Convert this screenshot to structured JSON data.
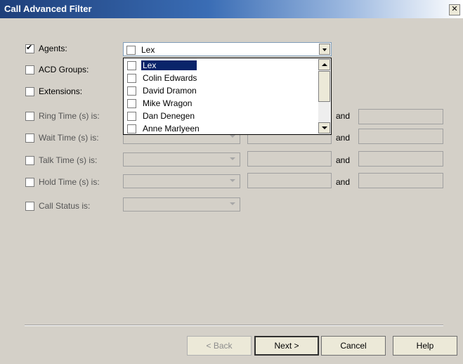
{
  "window": {
    "title": "Call Advanced Filter",
    "close_label": "✕"
  },
  "filters": {
    "agents": {
      "label": "Agents:",
      "checked": true,
      "selected": "Lex"
    },
    "acd_groups": {
      "label": "ACD Groups:"
    },
    "extensions": {
      "label": "Extensions:"
    },
    "ring_time": {
      "label": "Ring Time (s) is:",
      "and": "and"
    },
    "wait_time": {
      "label": "Wait Time (s) is:",
      "and": "and"
    },
    "talk_time": {
      "label": "Talk Time (s) is:",
      "and": "and"
    },
    "hold_time": {
      "label": "Hold Time (s) is:",
      "and": "and"
    },
    "call_status": {
      "label": "Call Status is:"
    }
  },
  "agents_list": [
    "Lex",
    "Colin Edwards",
    "David Dramon",
    "Mike Wragon",
    "Dan Denegen",
    "Anne Marlyeen"
  ],
  "buttons": {
    "back": "< Back",
    "next": "Next >",
    "cancel": "Cancel",
    "help": "Help"
  }
}
